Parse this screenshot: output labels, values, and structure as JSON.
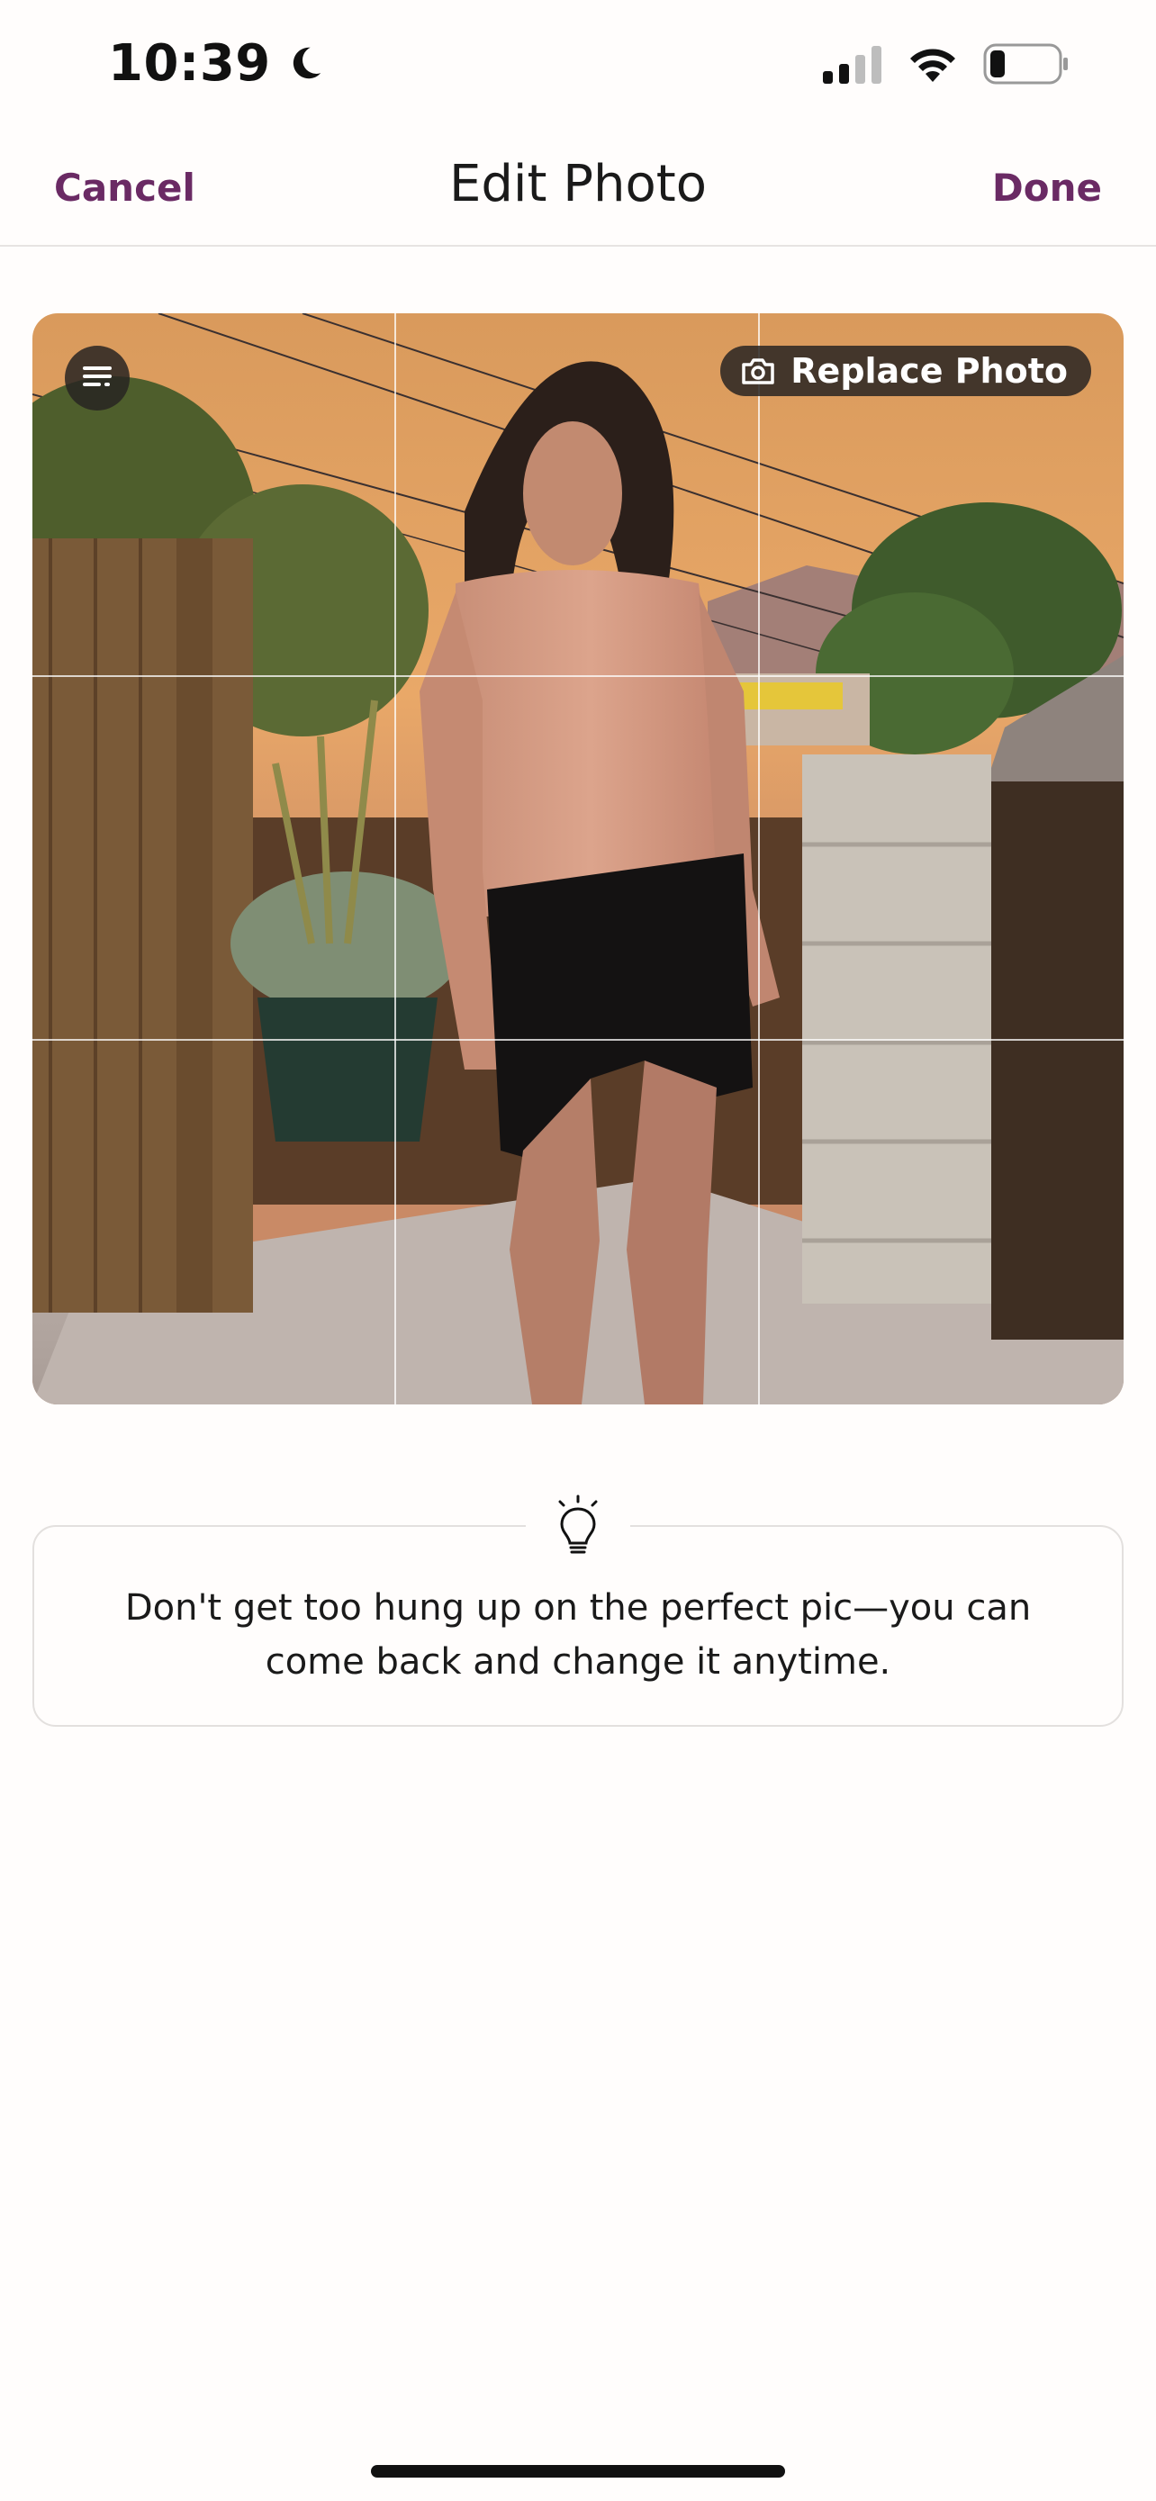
{
  "status_bar": {
    "time": "10:39",
    "icons": [
      "moon-icon",
      "cellular-signal-icon",
      "wifi-icon",
      "battery-icon"
    ]
  },
  "header": {
    "cancel_label": "Cancel",
    "title": "Edit Photo",
    "done_label": "Done"
  },
  "photo_editor": {
    "replace_label": "Replace Photo",
    "menu_icon": "align-menu-icon",
    "grid": "3x3"
  },
  "tip": {
    "icon": "lightbulb-icon",
    "text": "Don't get too hung up on the perfect pic—you can come back and change it anytime."
  },
  "colors": {
    "accent": "#6a2a64",
    "background": "#fffdfc"
  }
}
